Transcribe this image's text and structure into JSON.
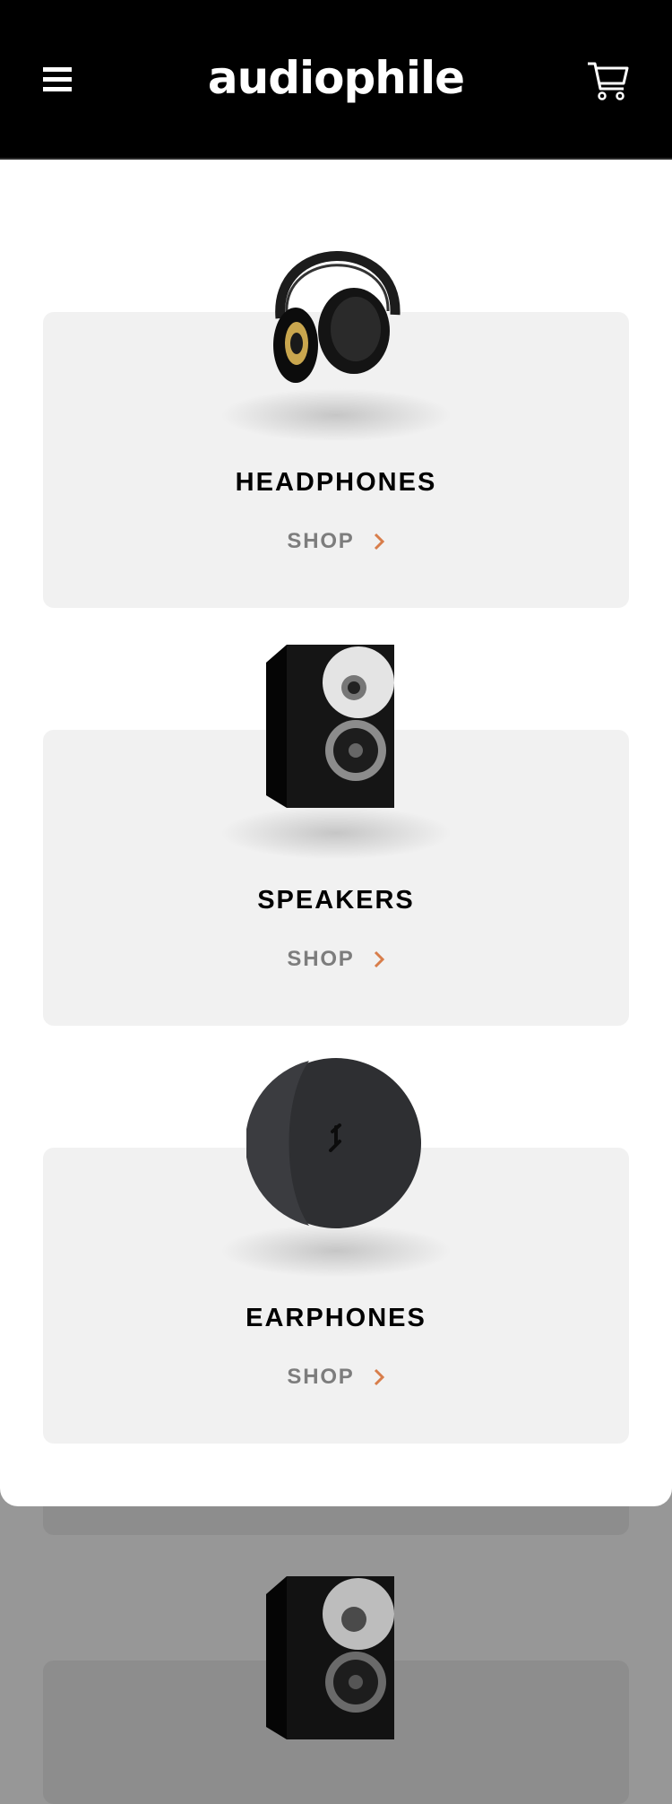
{
  "header": {
    "logo": "audiophile",
    "menu_icon": "hamburger-menu-icon",
    "cart_icon": "cart-icon"
  },
  "categories": [
    {
      "title": "HEADPHONES",
      "shop_label": "SHOP",
      "image": "headphones-image"
    },
    {
      "title": "SPEAKERS",
      "shop_label": "SHOP",
      "image": "speaker-image"
    },
    {
      "title": "EARPHONES",
      "shop_label": "SHOP",
      "image": "earphones-image"
    }
  ],
  "colors": {
    "accent": "#d87d4a",
    "header_bg": "#000000",
    "card_bg": "#f1f1f1",
    "backdrop": "#979797"
  }
}
